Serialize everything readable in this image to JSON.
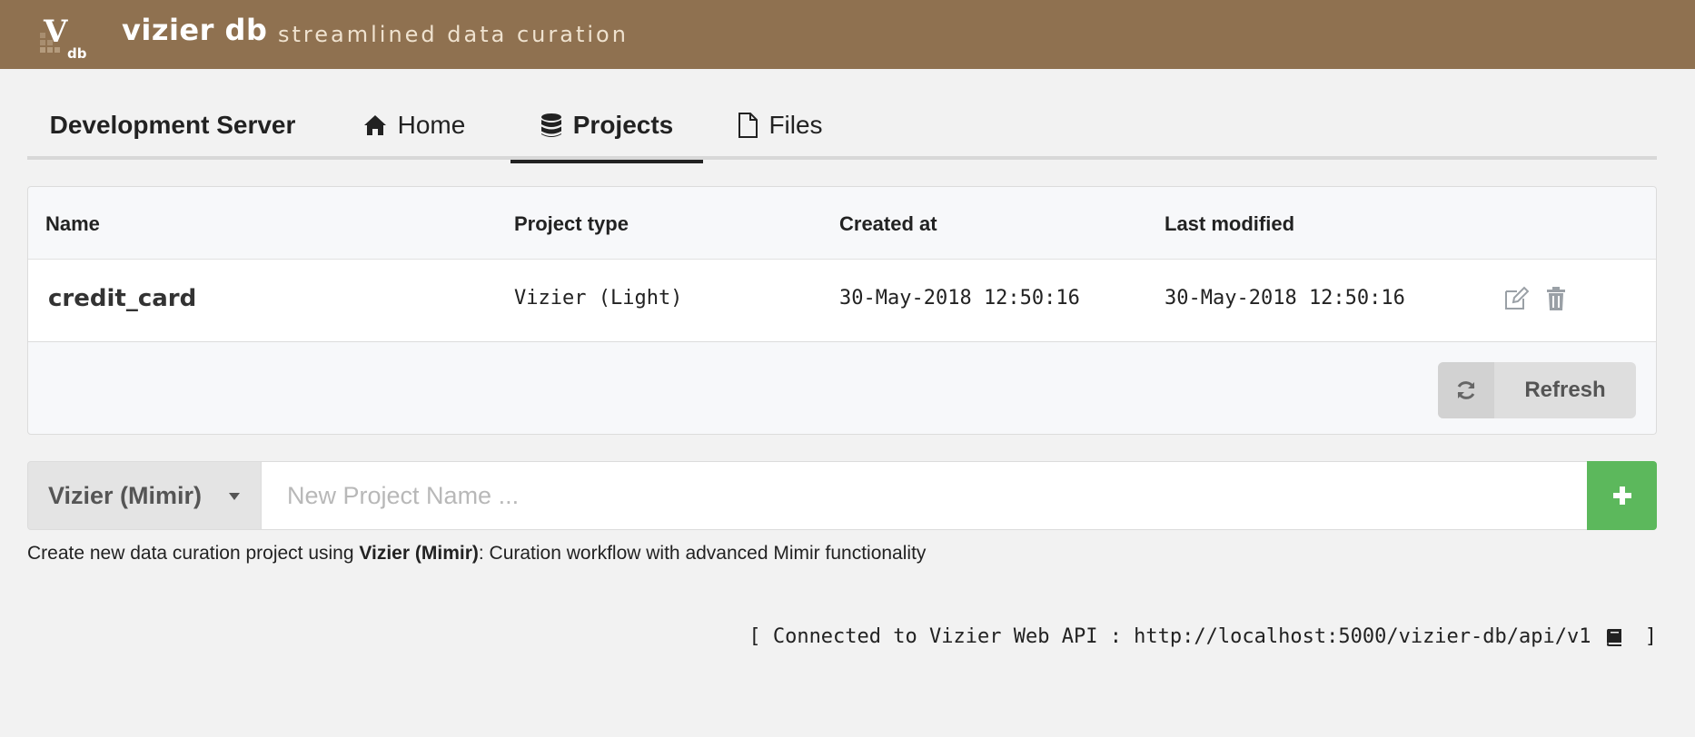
{
  "header": {
    "app_name": "vizier db",
    "tagline": "streamlined data curation",
    "logo_letter": "V",
    "logo_sub": "db"
  },
  "tabs": {
    "server_label": "Development Server",
    "home_label": "Home",
    "projects_label": "Projects",
    "files_label": "Files",
    "active": "Projects"
  },
  "table": {
    "columns": [
      "Name",
      "Project type",
      "Created at",
      "Last modified"
    ],
    "rows": [
      {
        "name": "credit_card",
        "type": "Vizier (Light)",
        "created_at": "30-May-2018 12:50:16",
        "last_modified": "30-May-2018 12:50:16"
      }
    ],
    "refresh_label": "Refresh"
  },
  "new_project": {
    "type_selected": "Vizier (Mimir)",
    "name_value": "",
    "name_placeholder": "New Project Name ...",
    "add_symbol": "+"
  },
  "hint": {
    "prefix": "Create new data curation project using ",
    "type_name": "Vizier (Mimir)",
    "suffix": ": Curation workflow with advanced Mimir functionality"
  },
  "footer": {
    "open": "[ ",
    "text": "Connected to Vizier Web API : http://localhost:5000/vizier-db/api/v1",
    "close": " ]"
  },
  "colors": {
    "header_bg": "#8f7150",
    "add_button": "#5cb85c",
    "page_bg": "#f2f2f2"
  },
  "icons": {
    "home": "home-icon",
    "projects": "database-icon",
    "files": "file-icon",
    "edit": "edit-icon",
    "delete": "trash-icon",
    "refresh": "refresh-icon",
    "dropdown": "caret-down-icon",
    "add": "plus-icon",
    "docs": "book-icon"
  }
}
